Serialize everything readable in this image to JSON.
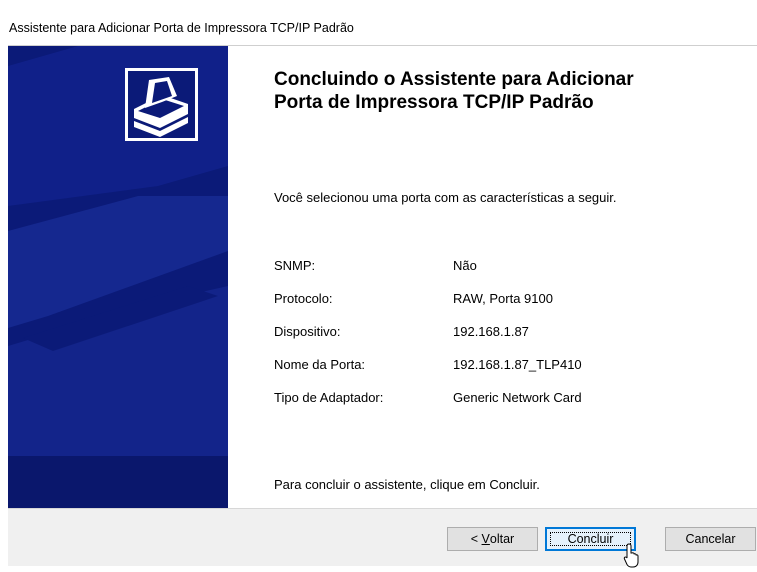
{
  "window": {
    "title": "Assistente para Adicionar Porta de Impressora TCP/IP Padrão"
  },
  "main": {
    "heading_line1": "Concluindo o Assistente para Adicionar",
    "heading_line2": "Porta de Impressora TCP/IP Padrão",
    "intro": "Você selecionou uma porta com as características a seguir.",
    "details": [
      {
        "label": "SNMP:",
        "value": "Não"
      },
      {
        "label": "Protocolo:",
        "value": "RAW, Porta 9100"
      },
      {
        "label": "Dispositivo:",
        "value": "192.168.1.87"
      },
      {
        "label": "Nome da Porta:",
        "value": "192.168.1.87_TLP410"
      },
      {
        "label": "Tipo de Adaptador:",
        "value": "Generic Network Card"
      }
    ],
    "finish_note": "Para concluir o assistente, clique em Concluir."
  },
  "footer": {
    "back_prefix": "< ",
    "back_mnemonic": "V",
    "back_rest": "oltar",
    "finish_label": "Concluir",
    "cancel_label": "Cancelar"
  },
  "colors": {
    "banner": "#0b1a78",
    "banner_shape": "#15288f",
    "focus": "#0078d7"
  },
  "icons": [
    "printer-icon",
    "mouse-cursor-icon"
  ]
}
